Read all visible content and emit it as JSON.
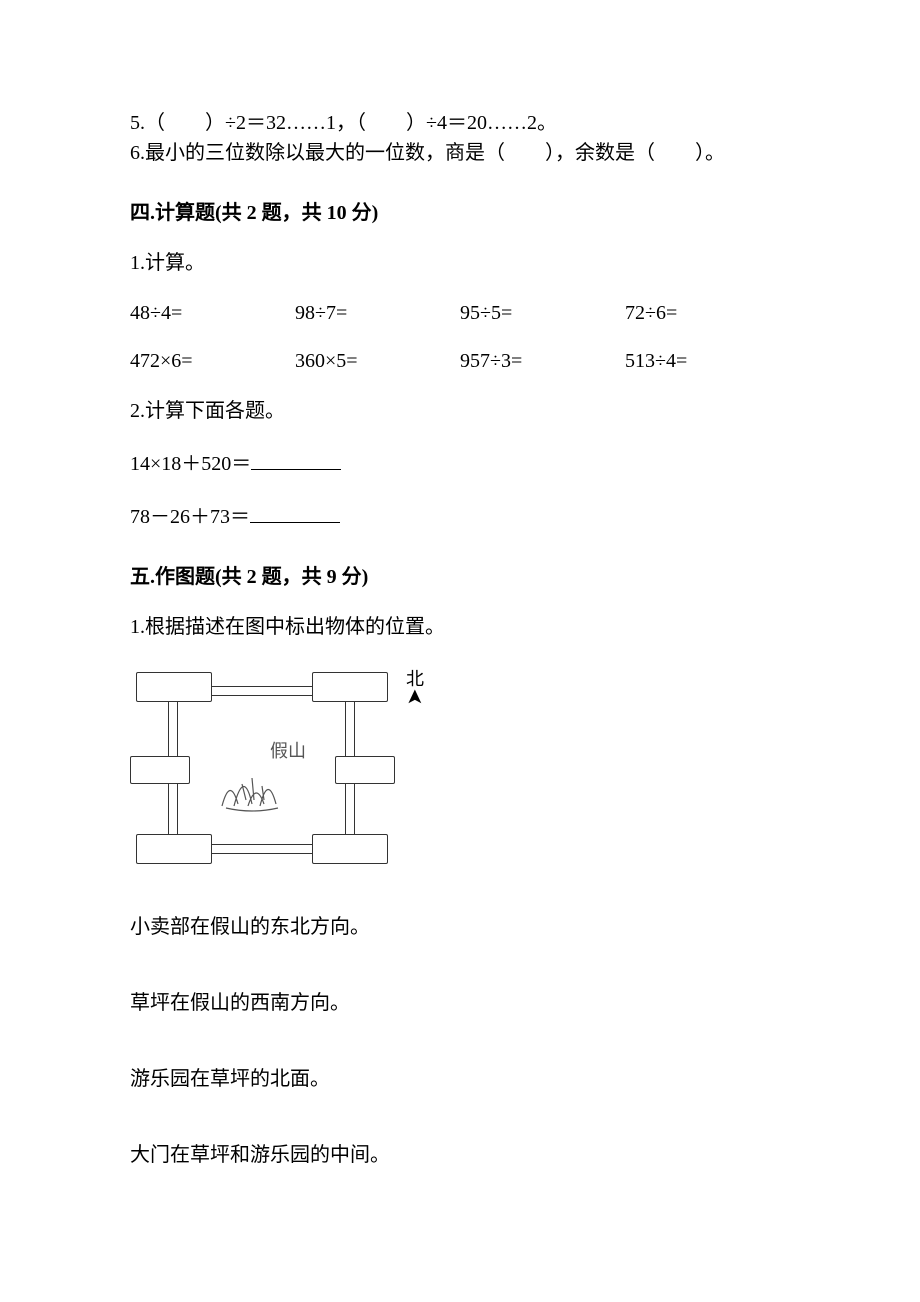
{
  "fill": {
    "q5": "5.（　　）÷2＝32……1，（　　）÷4＝20……2。",
    "q6": "6.最小的三位数除以最大的一位数，商是（　　），余数是（　　）。"
  },
  "section4_title": "四.计算题(共 2 题，共 10 分)",
  "calc": {
    "q1_label": "1.计算。",
    "row1": {
      "c1": "48÷4=",
      "c2": "98÷7=",
      "c3": "95÷5=",
      "c4": "72÷6="
    },
    "row2": {
      "c1": "472×6=",
      "c2": "360×5=",
      "c3": "957÷3=",
      "c4": "513÷4="
    },
    "q2_label": "2.计算下面各题。",
    "eq1_lhs": "14×18＋520＝",
    "eq2_lhs": "78－26＋73＝"
  },
  "section5_title": "五.作图题(共 2 题，共 9 分)",
  "drawing": {
    "q1_label": "1.根据描述在图中标出物体的位置。",
    "north_char": "北",
    "center_label": "假山",
    "s1": "小卖部在假山的东北方向。",
    "s2": "草坪在假山的西南方向。",
    "s3": "游乐园在草坪的北面。",
    "s4": "大门在草坪和游乐园的中间。"
  }
}
